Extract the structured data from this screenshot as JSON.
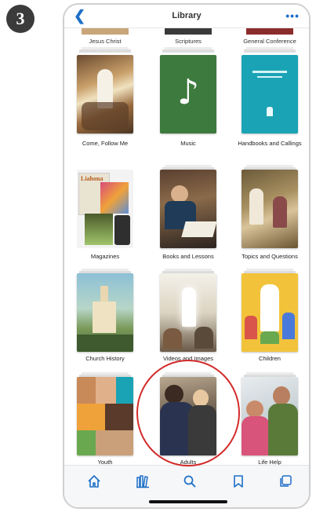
{
  "step_number": "3",
  "navbar": {
    "back_icon": "chevron-left-icon",
    "title": "Library",
    "more_icon": "more-dots-icon"
  },
  "top_row_labels": [
    "Jesus Christ",
    "Scriptures",
    "General Conference"
  ],
  "tiles": [
    {
      "label": "Come, Follow Me"
    },
    {
      "label": "Music"
    },
    {
      "label": "Handbooks and Callings"
    },
    {
      "label": "Magazines"
    },
    {
      "label": "Books and Lessons"
    },
    {
      "label": "Topics and Questions"
    },
    {
      "label": "Church History"
    },
    {
      "label": "Videos and Images"
    },
    {
      "label": "Children"
    },
    {
      "label": "Youth"
    },
    {
      "label": "Adults"
    },
    {
      "label": "Life Help"
    }
  ],
  "magazine_title": "Liahona",
  "tabbar": [
    "home-icon",
    "library-icon",
    "search-icon",
    "bookmark-icon",
    "screens-icon"
  ],
  "colors": {
    "accent": "#1d6fc7",
    "highlight": "#d32a2a",
    "music_cover": "#3d7a3d",
    "handbooks_cover": "#1aa3b5"
  }
}
